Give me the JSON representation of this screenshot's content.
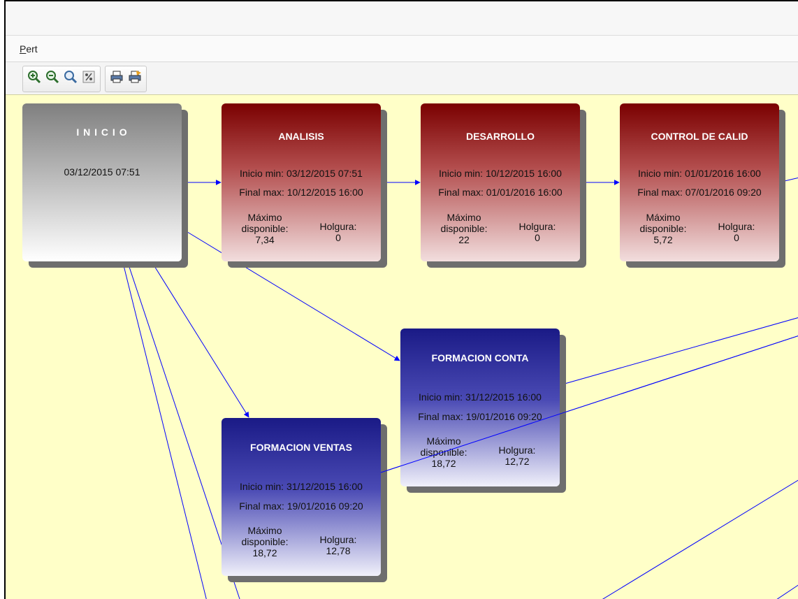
{
  "menu": {
    "pert_label": "Pert",
    "pert_mnemonic": "P",
    "pert_rest": "ert"
  },
  "toolbar": {
    "buttons": [
      "zoom-in-icon",
      "zoom-out-icon",
      "zoom-reset-icon",
      "zoom-percent-icon",
      "print-icon",
      "print-preview-icon"
    ]
  },
  "colors": {
    "canvas": "#ffffc8",
    "link": "#0000ff",
    "critical_task": "#7a0000",
    "normal_task": "#1a1a86"
  },
  "nodes": {
    "inicio": {
      "title": "I N I C I O",
      "date": "03/12/2015 07:51"
    },
    "analisis": {
      "title": "ANALISIS",
      "inicio": "Inicio min: 03/12/2015 07:51",
      "final": "Final max: 10/12/2015 16:00",
      "max_label_1": "Máximo",
      "max_label_2": "disponible:",
      "max_value": "7,34",
      "holgura_label": "Holgura:",
      "holgura_value": "0"
    },
    "desarrollo": {
      "title": "DESARROLLO",
      "inicio": "Inicio min: 10/12/2015 16:00",
      "final": "Final max: 01/01/2016 16:00",
      "max_label_1": "Máximo",
      "max_label_2": "disponible:",
      "max_value": "22",
      "holgura_label": "Holgura:",
      "holgura_value": "0"
    },
    "control": {
      "title": "CONTROL DE CALID",
      "inicio": "Inicio min: 01/01/2016 16:00",
      "final": "Final max: 07/01/2016 09:20",
      "max_label_1": "Máximo",
      "max_label_2": "disponible:",
      "max_value": "5,72",
      "holgura_label": "Holgura:",
      "holgura_value": "0"
    },
    "conta": {
      "title": "FORMACION CONTA",
      "inicio": "Inicio min: 31/12/2015 16:00",
      "final": "Final max: 19/01/2016 09:20",
      "max_label_1": "Máximo",
      "max_label_2": "disponible:",
      "max_value": "18,72",
      "holgura_label": "Holgura:",
      "holgura_value": "12,72"
    },
    "ventas": {
      "title": "FORMACION VENTAS",
      "inicio": "Inicio min: 31/12/2015 16:00",
      "final": "Final max: 19/01/2016 09:20",
      "max_label_1": "Máximo",
      "max_label_2": "disponible:",
      "max_value": "18,72",
      "holgura_label": "Holgura:",
      "holgura_value": "12,78"
    }
  }
}
